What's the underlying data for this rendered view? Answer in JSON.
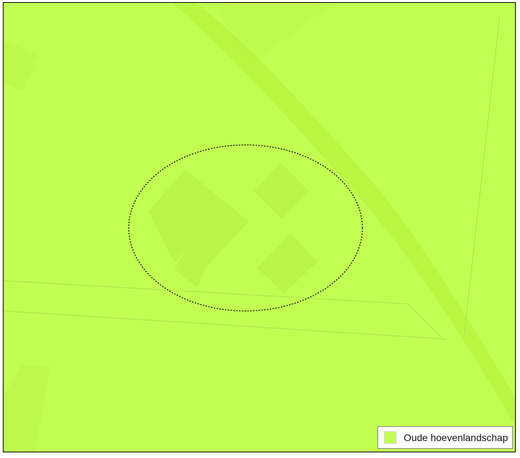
{
  "map": {
    "land_color": "#c2fd52",
    "feature_color": "#b9f447",
    "road_color": "#b7f23f",
    "line_color": "#a9e64a",
    "highlight_outline_color": "#000000"
  },
  "legend": {
    "items": [
      {
        "label": "Oude hoevenlandschap",
        "color": "#c2fd52"
      }
    ]
  }
}
